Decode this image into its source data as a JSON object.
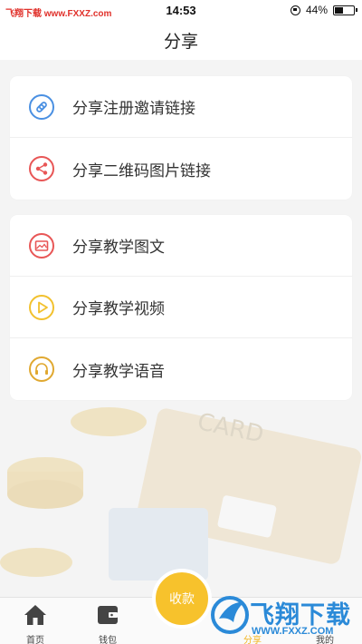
{
  "status_bar": {
    "watermark": "飞翔下载 www.FXXZ.com",
    "time": "14:53",
    "battery": "44%"
  },
  "nav": {
    "title": "分享"
  },
  "card1": {
    "items": [
      {
        "label": "分享注册邀请链接",
        "icon": "link-icon",
        "color": "#4a90e2"
      },
      {
        "label": "分享二维码图片链接",
        "icon": "share-icon",
        "color": "#e85656"
      }
    ]
  },
  "card2": {
    "items": [
      {
        "label": "分享教学图文",
        "icon": "image-icon",
        "color": "#e85656"
      },
      {
        "label": "分享教学视频",
        "icon": "play-icon",
        "color": "#f2c12e"
      },
      {
        "label": "分享教学语音",
        "icon": "headphones-icon",
        "color": "#e0a830"
      }
    ]
  },
  "tabbar": {
    "home": "首页",
    "wallet": "钱包",
    "collect": "收款",
    "share": "分享",
    "mine": "我的"
  },
  "logo_overlay": {
    "brand": "飞翔下载",
    "url": "WWW.FXXZ.COM"
  },
  "background_illustration": {
    "card_text": "CARD"
  },
  "colors": {
    "accent": "#f7c22c",
    "active_tab": "#f2b51f",
    "logo_blue": "#2b8ad8"
  }
}
